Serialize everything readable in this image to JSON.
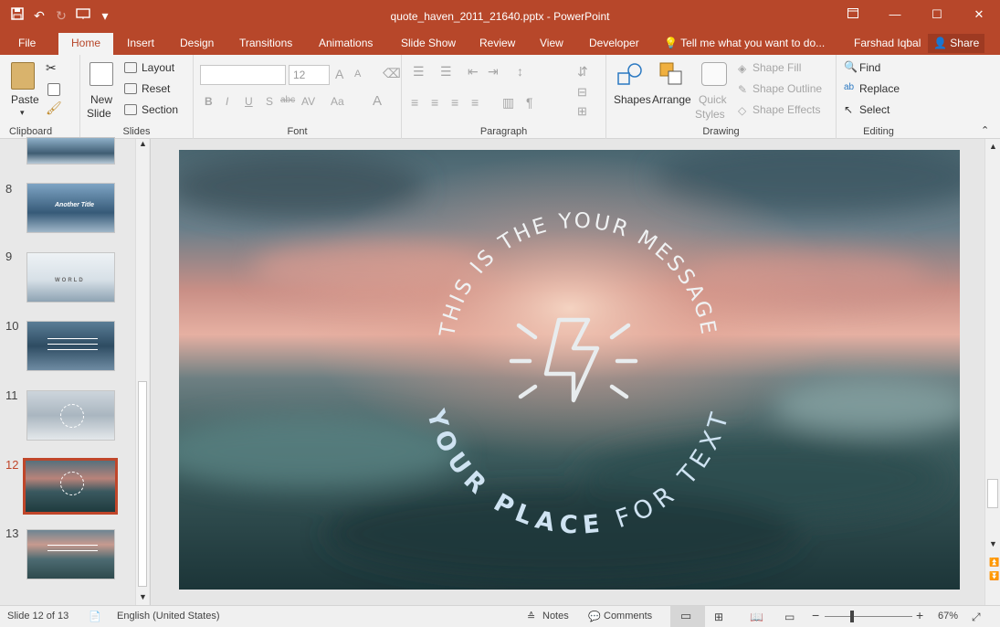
{
  "window": {
    "title": "quote_haven_2011_21640.pptx - PowerPoint",
    "minimize": "—",
    "maximize": "☐",
    "close": "✕"
  },
  "qat": {
    "save": "💾",
    "undo": "↶",
    "redo": "↻",
    "customize": "▾"
  },
  "tabs": [
    "File",
    "Home",
    "Insert",
    "Design",
    "Transitions",
    "Animations",
    "Slide Show",
    "Review",
    "View",
    "Developer"
  ],
  "tell_me": "Tell me what you want to do...",
  "user": "Farshad Iqbal",
  "share": "Share",
  "ribbon": {
    "clipboard": {
      "label": "Clipboard",
      "paste": "Paste"
    },
    "slides": {
      "label": "Slides",
      "new_slide_1": "New",
      "new_slide_2": "Slide",
      "layout": "Layout",
      "reset": "Reset",
      "section": "Section"
    },
    "font": {
      "label": "Font",
      "size": "12",
      "bold": "B",
      "italic": "I",
      "underline": "U",
      "shadow": "S",
      "strike": "abc",
      "spacing": "AV",
      "case": "Aa",
      "color": "A"
    },
    "paragraph": {
      "label": "Paragraph"
    },
    "drawing": {
      "label": "Drawing",
      "shapes": "Shapes",
      "arrange": "Arrange",
      "quick_styles_1": "Quick",
      "quick_styles_2": "Styles",
      "shape_fill": "Shape Fill",
      "shape_outline": "Shape Outline",
      "shape_effects": "Shape Effects"
    },
    "editing": {
      "label": "Editing",
      "find": "Find",
      "replace": "Replace",
      "select": "Select"
    }
  },
  "thumbnails": [
    {
      "num": "8",
      "title": "Another Title"
    },
    {
      "num": "9",
      "title": "WORLD"
    },
    {
      "num": "10"
    },
    {
      "num": "11"
    },
    {
      "num": "12"
    },
    {
      "num": "13"
    }
  ],
  "slide": {
    "arc_top": "THIS IS THE YOUR MESSAGE",
    "arc_bottom_1": "YOUR ",
    "arc_bottom_2": "PLACE",
    "arc_bottom_3": " FOR TEXT"
  },
  "status": {
    "slide_info": "Slide 12 of 13",
    "language": "English (United States)",
    "notes": "Notes",
    "comments": "Comments",
    "zoom": "67%"
  },
  "colors": {
    "accent": "#b7472a",
    "selected_thumb": "#c0462a"
  }
}
